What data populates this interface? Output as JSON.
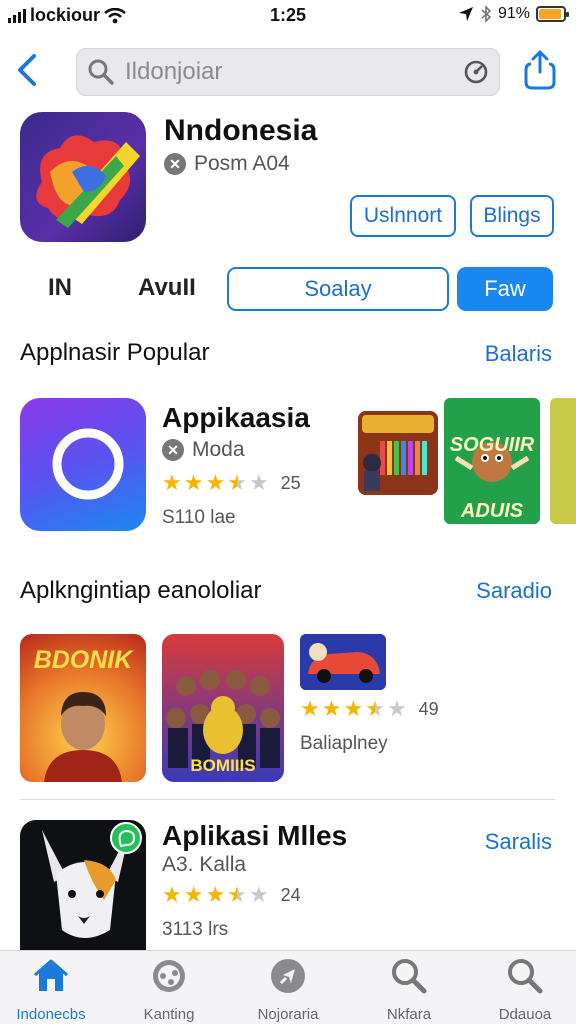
{
  "status_bar": {
    "carrier": "lockiour",
    "time": "1:25",
    "battery": "91%",
    "battery_level": 0.9
  },
  "search": {
    "placeholder": "Ildonjoiar"
  },
  "header_app": {
    "title": "Nndonesia",
    "subtitle": "Posm A04",
    "button_1": "Uslnnort",
    "button_2": "Blings"
  },
  "segments": [
    {
      "label": "IN"
    },
    {
      "label": "AvuII"
    },
    {
      "label": "Soalay"
    },
    {
      "label": "Faw",
      "selected": true
    }
  ],
  "popular": {
    "title": "Applnasir Popular",
    "link": "Balaris",
    "app": {
      "name": "Appikaasia",
      "developer": "Moda",
      "rating": 3.5,
      "rating_count": "25",
      "size": "S110 lae"
    },
    "thumb_1_text": "SOGUIIR ADUIS"
  },
  "second": {
    "title": "Aplkngintiap eanololiar",
    "link": "Saradio",
    "tile_1_text": "BDONIK",
    "tile_2_text": "BOMIIIS",
    "rating": 3.5,
    "rating_count": "49",
    "caption": "Baliaplney"
  },
  "third": {
    "title": "Aplikasi Mlles",
    "link": "Saralis",
    "developer": "A3. Kalla",
    "rating": 3.5,
    "rating_count": "24",
    "size": "3113 lrs"
  },
  "tabs": [
    {
      "label": "Indonecbs",
      "icon": "home-icon",
      "active": true
    },
    {
      "label": "Kanting",
      "icon": "games-icon"
    },
    {
      "label": "Nojoraria",
      "icon": "compass-icon"
    },
    {
      "label": "Nkfara",
      "icon": "search-icon"
    },
    {
      "label": "Ddauoa",
      "icon": "search-icon"
    }
  ],
  "colors": {
    "accent": "#1a7ad9",
    "star": "#f4b400",
    "battery": "#f6a623"
  }
}
